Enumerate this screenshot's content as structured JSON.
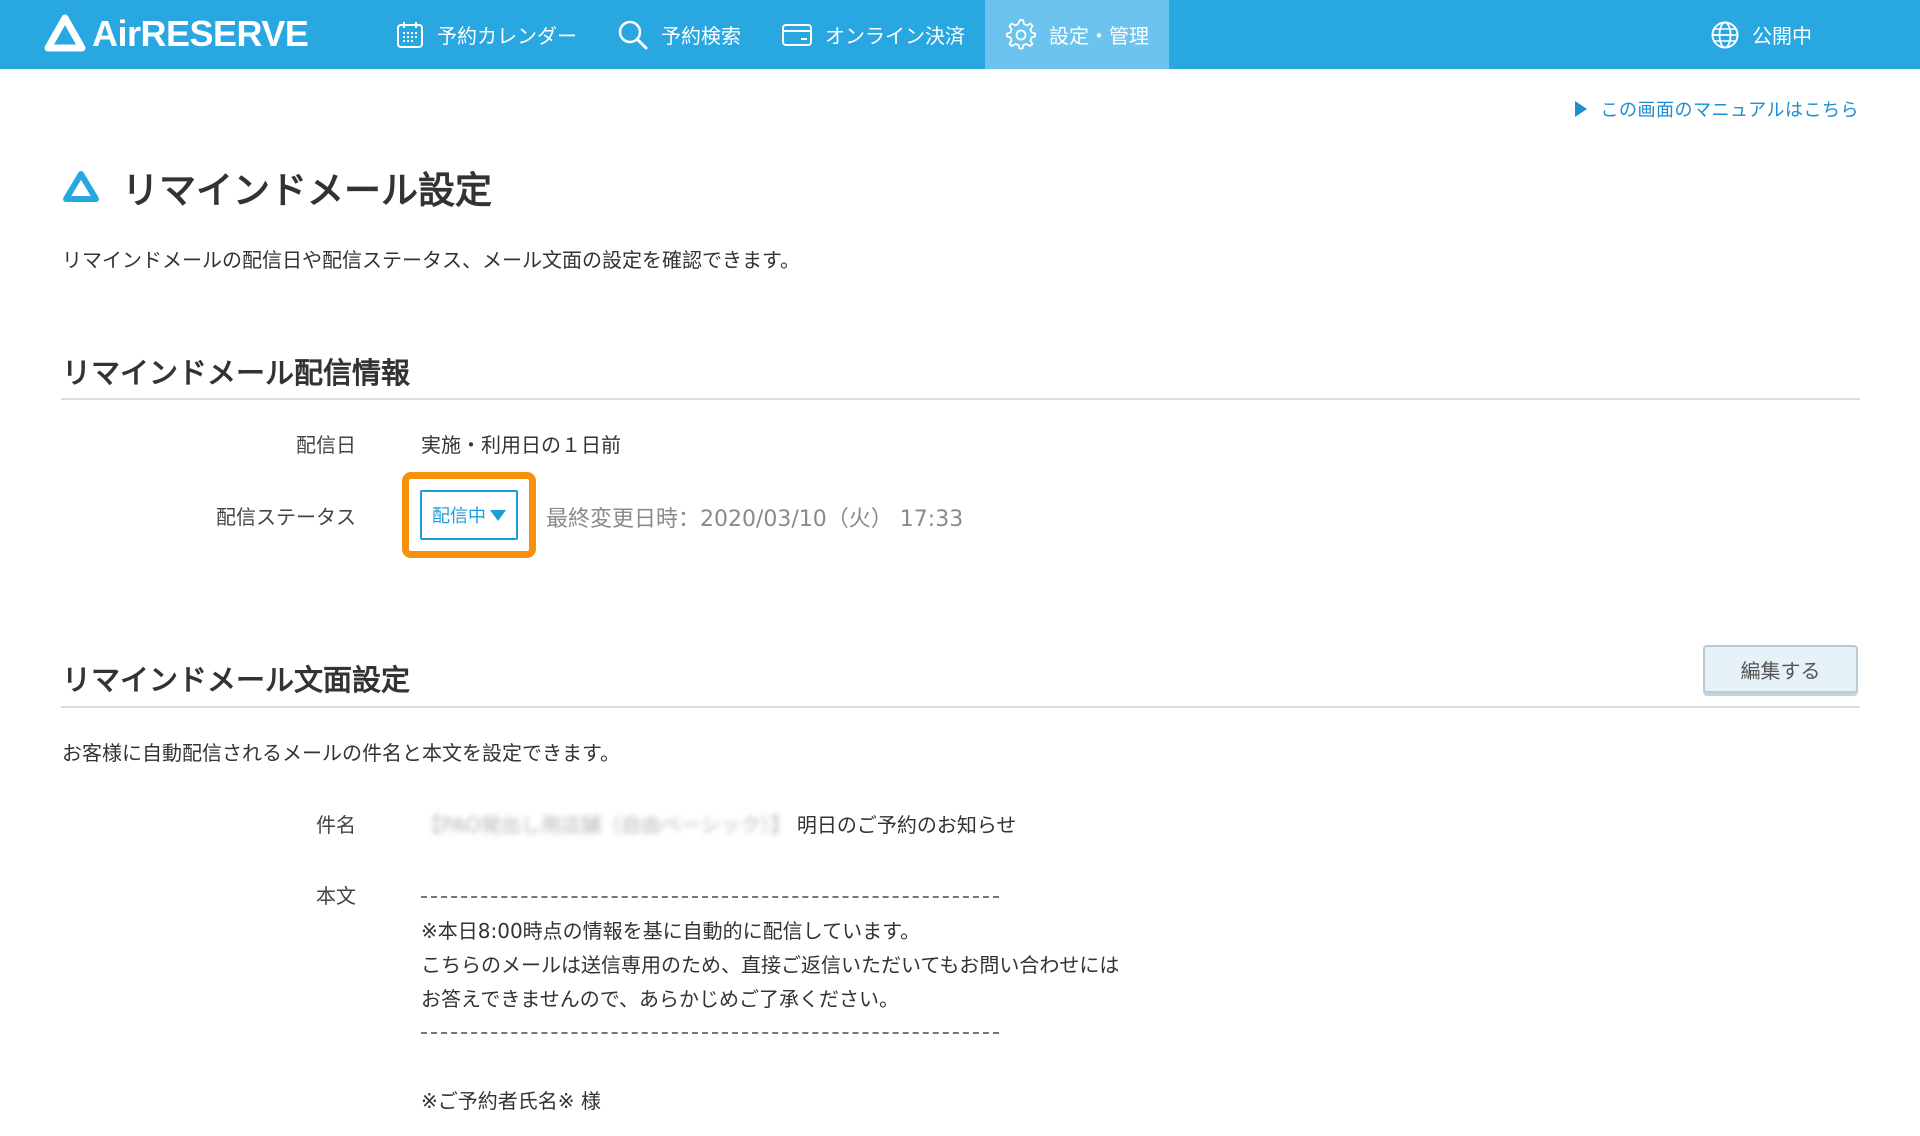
{
  "header": {
    "brand": "AirRESERVE",
    "nav": [
      {
        "label": "予約カレンダー",
        "icon": "calendar-icon"
      },
      {
        "label": "予約検索",
        "icon": "search-icon"
      },
      {
        "label": "オンライン決済",
        "icon": "card-icon"
      },
      {
        "label": "設定・管理",
        "icon": "gear-icon",
        "active": true
      }
    ],
    "publish_status": "公開中",
    "bar_color": "#29a7e1",
    "active_color": "#6cc4ee"
  },
  "manual_link": "この画面のマニュアルはこちら",
  "page": {
    "title": "リマインドメール設定",
    "description": "リマインドメールの配信日や配信ステータス、メール文面の設定を確認できます。"
  },
  "delivery_info": {
    "section_title": "リマインドメール配信情報",
    "date_label": "配信日",
    "date_value": "実施・利用日の１日前",
    "status_label": "配信ステータス",
    "status_value": "配信中",
    "updated_at": "最終変更日時：2020/03/10（火） 17:33",
    "highlight_color": "#f7900a"
  },
  "mail_settings": {
    "section_title": "リマインドメール文面設定",
    "edit_button": "編集する",
    "description": "お客様に自動配信されるメールの件名と本文を設定できます。",
    "subject_label": "件名",
    "subject_blurred": "【PAO発出し用店舗（自由ベーシック）】",
    "subject_text": "明日のご予約のお知らせ",
    "body_label": "本文",
    "body_lines": [
      "※本日8:00時点の情報を基に自動的に配信しています。",
      "こちらのメールは送信専用のため、直接ご返信いただいてもお問い合わせには",
      "お答えできませんので、あらかじめご了承ください。"
    ],
    "greeting": "※ご予約者氏名※ 様"
  }
}
